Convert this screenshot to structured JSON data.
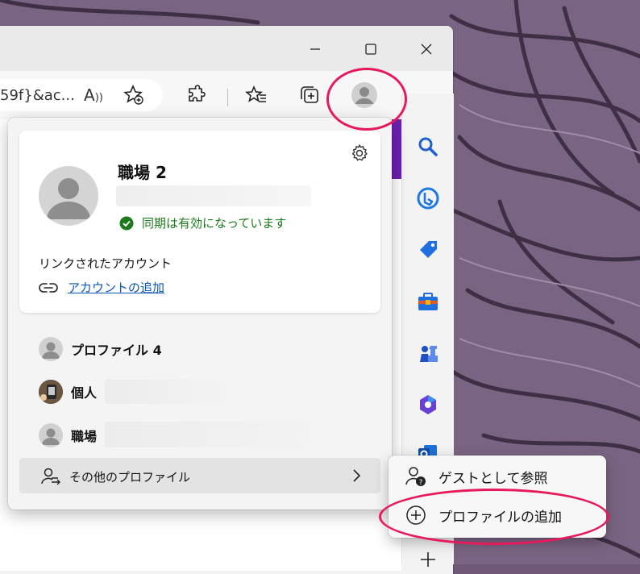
{
  "window": {
    "controls": {
      "minimize_icon": "minimize-icon",
      "maximize_icon": "maximize-icon",
      "close_icon": "close-icon"
    }
  },
  "toolbar": {
    "url_fragment": "59f}&ac...",
    "read_aloud_glyph": "A",
    "icons": [
      "read-aloud-icon",
      "add-favorite-icon",
      "extensions-icon",
      "favorites-icon",
      "collections-icon",
      "profile-icon",
      "more-icon"
    ]
  },
  "sidebar": {
    "icons": [
      "search-icon",
      "bing-icon",
      "shopping-icon",
      "tools-icon",
      "games-icon",
      "office-icon",
      "outlook-icon",
      "add-icon"
    ]
  },
  "profile_card": {
    "name": "職場 2",
    "sync_status": "同期は有効になっています",
    "linked_accounts_label": "リンクされたアカウント",
    "add_account_label": "アカウントの追加"
  },
  "profiles": [
    {
      "label": "プロファイル 4"
    },
    {
      "label": "個人"
    },
    {
      "label": "職場"
    }
  ],
  "other_profiles_label": "その他のプロファイル",
  "submenu": {
    "guest_label": "ゲストとして参照",
    "add_profile_label": "プロファイルの追加"
  },
  "colors": {
    "highlight": "#e8195a",
    "sync_green": "#1b7a1b",
    "link_blue": "#0a55b8",
    "accent_purple": "#6e1fb0"
  }
}
